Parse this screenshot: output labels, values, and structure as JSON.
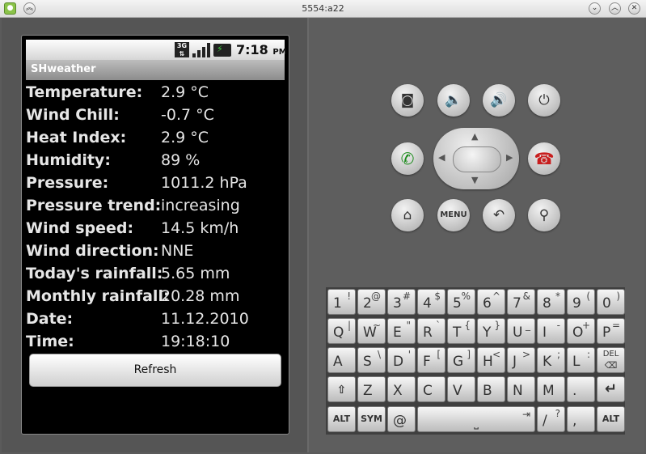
{
  "window": {
    "title": "5554:a22"
  },
  "status": {
    "network": "3G",
    "time": "7:18",
    "ampm": "PM"
  },
  "app": {
    "title": "SHweather"
  },
  "weather": [
    {
      "label": "Temperature:",
      "value": "2.9 °C"
    },
    {
      "label": "Wind Chill:",
      "value": "-0.7 °C"
    },
    {
      "label": "Heat Index:",
      "value": "2.9 °C"
    },
    {
      "label": "Humidity:",
      "value": "89 %"
    },
    {
      "label": "Pressure:",
      "value": "1011.2 hPa"
    },
    {
      "label": "Pressure trend:",
      "value": "increasing"
    },
    {
      "label": "Wind speed:",
      "value": "14.5 km/h"
    },
    {
      "label": "Wind direction:",
      "value": "NNE"
    },
    {
      "label": "Today's rainfall:",
      "value": "5.65 mm"
    },
    {
      "label": "Monthly rainfall:",
      "value": "20.28 mm"
    },
    {
      "label": "Date:",
      "value": "11.12.2010"
    },
    {
      "label": "Time:",
      "value": "19:18:10"
    }
  ],
  "refresh_label": "Refresh",
  "hw": {
    "menu": "MENU"
  },
  "keyboard": {
    "row1": [
      [
        "1",
        "!"
      ],
      [
        "2",
        "@"
      ],
      [
        "3",
        "#"
      ],
      [
        "4",
        "$"
      ],
      [
        "5",
        "%"
      ],
      [
        "6",
        "^"
      ],
      [
        "7",
        "&"
      ],
      [
        "8",
        "*"
      ],
      [
        "9",
        "("
      ],
      [
        "0",
        ")"
      ]
    ],
    "row2": [
      [
        "Q",
        "|"
      ],
      [
        "W",
        "~"
      ],
      [
        "E",
        "\""
      ],
      [
        "R",
        "`"
      ],
      [
        "T",
        "{"
      ],
      [
        "Y",
        "}"
      ],
      [
        "U",
        "_"
      ],
      [
        "I",
        "-"
      ],
      [
        "O",
        "+"
      ],
      [
        "P",
        "="
      ]
    ],
    "row3": [
      [
        "A",
        ""
      ],
      [
        "S",
        "\\"
      ],
      [
        "D",
        "'"
      ],
      [
        "F",
        "["
      ],
      [
        "G",
        "]"
      ],
      [
        "H",
        "<"
      ],
      [
        "J",
        ">"
      ],
      [
        "K",
        ";"
      ],
      [
        "L",
        ":"
      ]
    ],
    "row4": [
      "Z",
      "X",
      "C",
      "V",
      "B",
      "N",
      "M",
      "."
    ],
    "del": "DEL",
    "alt": "ALT",
    "sym": "SYM",
    "at": "@",
    "slash": "/",
    "question": "?",
    "comma": ","
  }
}
